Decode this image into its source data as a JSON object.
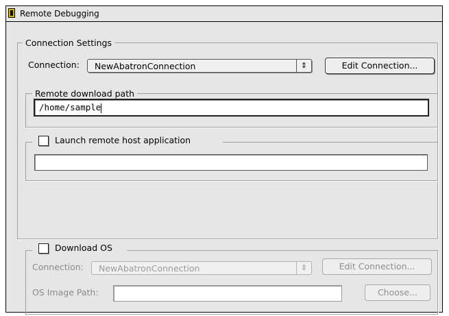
{
  "window": {
    "title": "Remote Debugging"
  },
  "connection_settings": {
    "legend": "Connection Settings",
    "connection_label": "Connection:",
    "connection_value": "NewAbatronConnection",
    "edit_connection_label": "Edit Connection...",
    "remote_download_path": {
      "legend": "Remote download path",
      "value": "/home/sample"
    },
    "launch_remote": {
      "label": "Launch remote host application",
      "checked": false,
      "value": ""
    }
  },
  "download_os": {
    "label": "Download OS",
    "checked": false,
    "connection_label": "Connection:",
    "connection_value": "NewAbatronConnection",
    "edit_connection_label": "Edit Connection...",
    "os_image_path_label": "OS Image Path:",
    "os_image_path_value": "",
    "choose_label": "Choose..."
  },
  "icons": {
    "title_icon": "app-icon",
    "popup_arrows": "up-down-arrows-icon"
  }
}
